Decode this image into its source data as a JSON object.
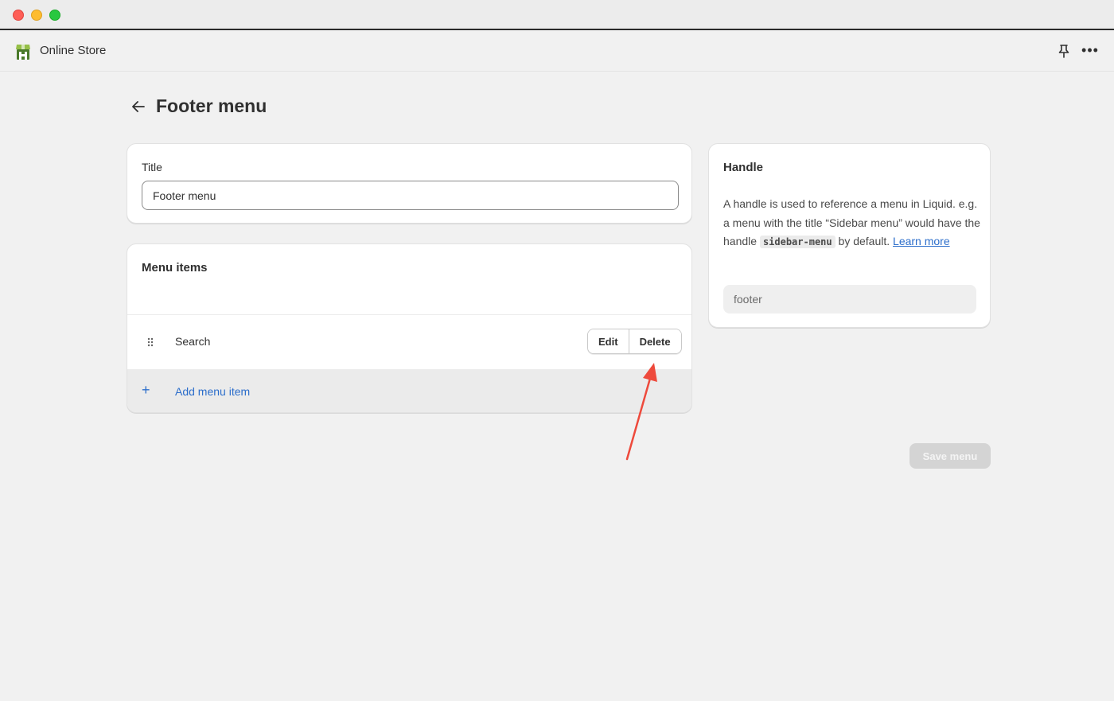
{
  "app": {
    "name": "Online Store",
    "logo_icon": "shopify-bag-icon"
  },
  "header": {
    "pin_icon": "pin-icon",
    "more_label": "•••"
  },
  "page": {
    "title": "Footer menu"
  },
  "title_card": {
    "label": "Title",
    "value": "Footer menu"
  },
  "menu_items": {
    "heading": "Menu items",
    "items": [
      {
        "label": "Search",
        "edit_label": "Edit",
        "delete_label": "Delete"
      }
    ],
    "add_label": "Add menu item",
    "add_icon": "+"
  },
  "handle": {
    "heading": "Handle",
    "desc_part1": "A handle is used to reference a menu in Liquid. e.g. a menu with the title “Sidebar menu” would have the handle ",
    "code": "sidebar-menu",
    "desc_part2": " by default. ",
    "learn_more": "Learn more",
    "value": "footer"
  },
  "actions": {
    "save_label": "Save menu"
  },
  "colors": {
    "accent_link": "#2c6ecb",
    "annotation_arrow": "#ee4a3c"
  }
}
